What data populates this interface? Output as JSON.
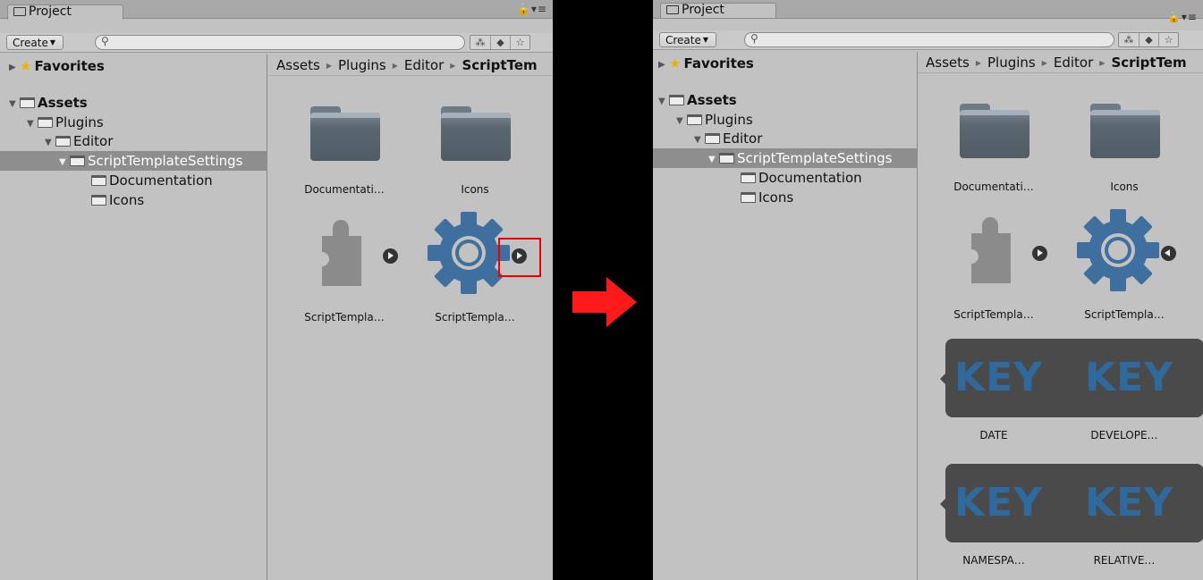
{
  "panels": {
    "before": {
      "tab_label": "Project",
      "create_label": "Create",
      "favorites_label": "Favorites",
      "tree": {
        "assets": "Assets",
        "plugins": "Plugins",
        "editor": "Editor",
        "script_template_settings": "ScriptTemplateSettings",
        "documentation": "Documentation",
        "icons": "Icons"
      },
      "breadcrumb": [
        "Assets",
        "Plugins",
        "Editor",
        "ScriptTem"
      ],
      "assets": [
        {
          "label": "Documentati…",
          "icon": "folder-icon"
        },
        {
          "label": "Icons",
          "icon": "folder-icon"
        },
        {
          "label": "ScriptTempla…",
          "icon": "puzzle-icon"
        },
        {
          "label": "ScriptTempla…",
          "icon": "gear-icon"
        }
      ]
    },
    "after": {
      "tab_label": "Project",
      "create_label": "Create",
      "favorites_label": "Favorites",
      "tree": {
        "assets": "Assets",
        "plugins": "Plugins",
        "editor": "Editor",
        "script_template_settings": "ScriptTemplateSettings",
        "documentation": "Documentation",
        "icons": "Icons"
      },
      "breadcrumb": [
        "Assets",
        "Plugins",
        "Editor",
        "ScriptTem"
      ],
      "assets": [
        {
          "label": "Documentati…",
          "icon": "folder-icon"
        },
        {
          "label": "Icons",
          "icon": "folder-icon"
        },
        {
          "label": "ScriptTempla…",
          "icon": "puzzle-icon"
        },
        {
          "label": "ScriptTempla…",
          "icon": "gear-icon"
        }
      ],
      "sub_assets": [
        {
          "label": "DATE",
          "key_text": "KEY"
        },
        {
          "label": "DEVELOPE…",
          "key_text": "KEY"
        },
        {
          "label": "NAMESPA…",
          "key_text": "KEY"
        },
        {
          "label": "RELATIVE…",
          "key_text": "KEY"
        }
      ]
    }
  },
  "colors": {
    "panel_bg": "#c2c2c2",
    "selection": "#8e8e8e",
    "highlight": "#e00000",
    "arrow": "#ff1a1a",
    "gear": "#3e6f9e",
    "key_tile": "#4a4a4a"
  }
}
